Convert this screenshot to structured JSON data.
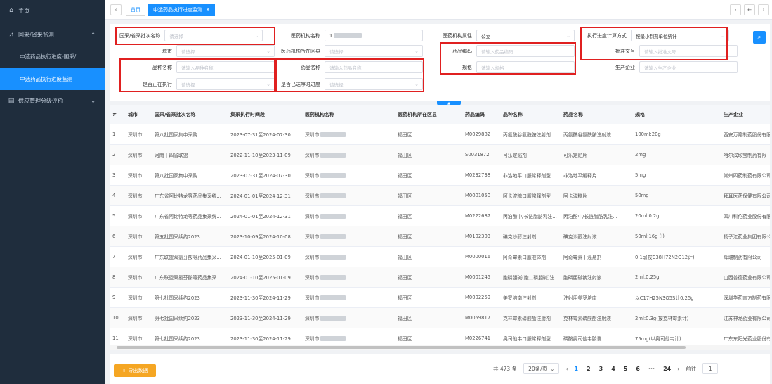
{
  "sidebar": {
    "home": "主页",
    "group1": "国采/省采监测",
    "sub1": "中选药品执行进度-国采/...",
    "sub2": "中选药品执行进度监测",
    "group2": "供应管理分级评价"
  },
  "tabs": {
    "home": "首页",
    "active": "中选药品执行进度监测"
  },
  "filters": {
    "batch_label": "国采/省采批次名称",
    "batch_ph": "请选择",
    "org_label": "医药机构名称",
    "org_val": "1",
    "orgattr_label": "医药机构属性",
    "orgattr_val": "公立",
    "calc_label": "执行进度计算方式",
    "calc_val": "按最小制剂单位统计",
    "city_label": "城市",
    "city_ph": "请选择",
    "district_label": "医药机构所在区县",
    "district_ph": "请选择",
    "code_label": "药品编码",
    "code_ph": "请输入药品编码",
    "approval_label": "批准文号",
    "approval_ph": "请输入批准文号",
    "variety_label": "品种名称",
    "variety_ph": "请输入品种名称",
    "drugname_label": "药品名称",
    "drugname_ph": "请输入药品名称",
    "spec_label": "规格",
    "spec_ph": "请输入规格",
    "maker_label": "生产企业",
    "maker_ph": "请输入生产企业",
    "executing_label": "是否正在执行",
    "executing_ph": "请选择",
    "ontime_label": "是否已达序时进度",
    "ontime_ph": "请选择"
  },
  "table": {
    "headers": [
      "#",
      "城市",
      "国采/省采批次名称",
      "集采执行时间段",
      "医药机构名称",
      "医药机构所在区县",
      "药品编码",
      "品种名称",
      "药品名称",
      "规格",
      "生产企业"
    ],
    "rows": [
      [
        "1",
        "深圳市",
        "第八批国家集中采购",
        "2023-07-31至2024-07-30",
        "深圳市",
        "福田区",
        "M0029882",
        "丙氨酰谷氨酰胺注射剂",
        "丙氨酰谷氨酰胺注射液",
        "100ml:20g",
        "西安万隆制药股份有限"
      ],
      [
        "2",
        "深圳市",
        "河南十四省联盟",
        "2022-11-10至2023-11-09",
        "深圳市",
        "福田区",
        "S0031872",
        "可乐定贴剂",
        "可乐定贴片",
        "2mg",
        "哈尔滨珍宝制药有限"
      ],
      [
        "3",
        "深圳市",
        "第八批国家集中采购",
        "2023-07-31至2024-07-30",
        "深圳市",
        "福田区",
        "M0232738",
        "非洛地平口服常释剂型",
        "非洛地平缓释片",
        "5mg",
        "常州四药制药有限公司"
      ],
      [
        "4",
        "深圳市",
        "广东省阿比特龙等药品集采统...",
        "2024-01-01至2024-12-31",
        "深圳市",
        "福田区",
        "M0001050",
        "阿卡波糖口服常释剂型",
        "阿卡波糖片",
        "50mg",
        "拜耳医药保健有限公司"
      ],
      [
        "5",
        "深圳市",
        "广东省阿比特龙等药品集采统...",
        "2024-01-01至2024-12-31",
        "深圳市",
        "福田区",
        "M0222687",
        "丙泊酚中/长链脂肪乳注...",
        "丙泊酚中/长链脂肪乳注...",
        "20ml:0.2g",
        "四川科伦药业股份有限"
      ],
      [
        "6",
        "深圳市",
        "第五批国采续约2023",
        "2023-10-09至2024-10-08",
        "深圳市",
        "福田区",
        "M0102303",
        "碘克沙醇注射剂",
        "碘克沙醇注射液",
        "50ml:16g (I)",
        "扬子江药业集团有限公"
      ],
      [
        "7",
        "深圳市",
        "广东联盟双氯芬酸等药品集采...",
        "2024-01-10至2025-01-09",
        "深圳市",
        "福田区",
        "M0000016",
        "阿奇霉素口服液体剂",
        "阿奇霉素干混悬剂",
        "0.1g(按C38H72N2O12计)",
        "辉瑞制药有限公司"
      ],
      [
        "8",
        "深圳市",
        "广东联盟双氯芬酸等药品集采...",
        "2024-01-10至2025-01-09",
        "深圳市",
        "福田区",
        "M0001245",
        "胞磷胆碱(胞二磷胆碱)注...",
        "胞磷胆碱钠注射液",
        "2ml:0.25g",
        "山西普德药业有限公司"
      ],
      [
        "9",
        "深圳市",
        "第七批国采续约2023",
        "2023-11-30至2024-11-29",
        "深圳市",
        "福田区",
        "M0002259",
        "美罗培南注射剂",
        "注射用美罗培南",
        "以C17H25N3O5S计0.25g",
        "深圳华药南方制药有限"
      ],
      [
        "10",
        "深圳市",
        "第七批国采续约2023",
        "2023-11-30至2024-11-29",
        "深圳市",
        "福田区",
        "M0059817",
        "克林霉素磷酸酯注射剂",
        "克林霉素磷酸酯注射液",
        "2ml:0.3g(按克林霉素计)",
        "江苏神龙药业有限公司"
      ],
      [
        "11",
        "深圳市",
        "第七批国采续约2023",
        "2023-11-30至2024-11-29",
        "深圳市",
        "福田区",
        "M0226741",
        "奥司他韦口服常释剂型",
        "磷酸奥司他韦胶囊",
        "75mg(以奥司他韦计)",
        "广东东阳光药业股份有"
      ]
    ]
  },
  "footer": {
    "export": "导出数据",
    "total": "共 473 条",
    "pagesize": "20条/页",
    "pages": [
      "1",
      "2",
      "3",
      "4",
      "5",
      "6",
      "···",
      "24"
    ],
    "goto_label": "前往",
    "goto_val": "1"
  }
}
